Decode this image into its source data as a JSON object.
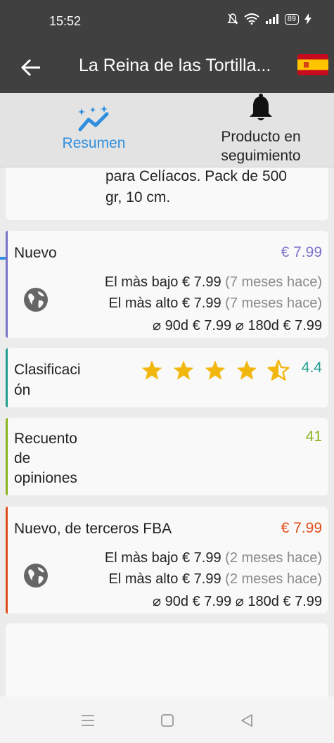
{
  "status": {
    "time": "15:52",
    "battery": "89"
  },
  "appbar": {
    "title": "La Reina de las Tortilla..."
  },
  "tabs": [
    {
      "label": "Resumen"
    },
    {
      "label_line1": "Producto en",
      "label_line2": "seguimiento"
    }
  ],
  "product": {
    "desc_line1": "para Celíacos. Pack de 500",
    "desc_line2": "gr, 10 cm."
  },
  "new_price": {
    "label": "Nuevo",
    "price": "€ 7.99",
    "lowest_label": "El màs bajo",
    "lowest_value": "€ 7.99",
    "lowest_ago": "(7 meses hace)",
    "highest_label": "El màs alto",
    "highest_value": "€ 7.99",
    "highest_ago": "(7 meses hace)",
    "avg90_label": "⌀ 90d",
    "avg90_value": "€ 7.99",
    "avg180_label": "⌀ 180d",
    "avg180_value": "€ 7.99"
  },
  "rating": {
    "label_line1": "Clasificaci",
    "label_line2": "ón",
    "value": "4.4",
    "stars": 4.4
  },
  "reviews": {
    "label_line1": "Recuento",
    "label_line2": "de",
    "label_line3": "opiniones",
    "value": "41"
  },
  "fba": {
    "label": "Nuevo, de terceros FBA",
    "price": "€ 7.99",
    "lowest_label": "El màs bajo",
    "lowest_value": "€ 7.99",
    "lowest_ago": "(2 meses hace)",
    "highest_label": "El màs alto",
    "highest_value": "€ 7.99",
    "highest_ago": "(2 meses hace)",
    "avg90_label": "⌀ 90d",
    "avg90_value": "€ 7.99",
    "avg180_label": "⌀ 180d",
    "avg180_value": "€ 7.99"
  },
  "colors": {
    "accent_blue": "#2f8fde",
    "new_price": "#7a74c9",
    "rating": "#1f9e90",
    "reviews": "#8ab31e",
    "fba": "#e04d1a",
    "star": "#f2b70f"
  },
  "icons": [
    "back-arrow-icon",
    "spain-flag-icon",
    "trend-chart-icon",
    "bell-icon",
    "globe-icon",
    "star-icon",
    "half-star-icon",
    "menu-icon",
    "home-square-icon",
    "back-triangle-icon"
  ]
}
